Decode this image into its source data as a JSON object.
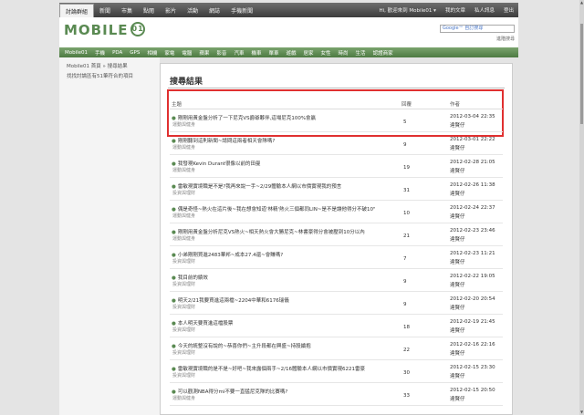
{
  "topnav": {
    "items": [
      "討論群組",
      "新聞",
      "市集",
      "點閱",
      "影片",
      "活動",
      "網誌",
      "手機新聞"
    ],
    "active": "討論群組",
    "right": [
      "Hi, 歡迎來到 Mobile01 ▾",
      "我的文章",
      "私人訊息",
      "登出"
    ]
  },
  "header": {
    "logo_text": "MOBILE",
    "logo_mark": "01",
    "search_placeholder": "Google™ 自訂搜尋",
    "advanced_label": "進階搜尋"
  },
  "categories": [
    "Mobile01",
    "手機",
    "PDA",
    "GPS",
    "相機",
    "家電",
    "電腦",
    "蘋果",
    "影音",
    "汽車",
    "機車",
    "單車",
    "遊戲",
    "居家",
    "女性",
    "時尚",
    "生活",
    "認證商家"
  ],
  "sidebar": {
    "breadcrumb": "Mobile01 首頁 » 搜尋結果",
    "hint": "找找討論區有51筆符合的項目"
  },
  "main": {
    "title": "搜尋結果",
    "columns": {
      "subject": "主題",
      "replies": "回覆",
      "author": "作者"
    },
    "rows": [
      {
        "title": "剛剛用黃金盤分析了一下尼克VS爵爺夥伴,這場尼克100%會贏",
        "section": "運動與健身",
        "replies": "5",
        "date": "2012-03-04 22:35",
        "author": "達賢仔"
      },
      {
        "title": "剛剛聽到這則新聞~請問這兩者相天會隊嗎?",
        "section": "運動與健身",
        "replies": "9",
        "date": "2012-03-01 22:22",
        "author": "達賢仔"
      },
      {
        "title": "我發現Kevin Durant很像以前的田曼",
        "section": "運動與健身",
        "replies": "19",
        "date": "2012-02-28 21:05",
        "author": "達賢仔"
      },
      {
        "title": "雷敏現實境職是不是?我再來說一手~2/29體驗本人網以市價實現我的預言",
        "section": "投資與理財",
        "replies": "31",
        "date": "2012-02-26 11:38",
        "author": "達賢仔"
      },
      {
        "title": "偶是奇怪~熱火在這片後~我在想會知道'林精'熱火三個都同LIN~是不是讓他得分不破10\"",
        "section": "運動與健身",
        "replies": "10",
        "date": "2012-02-24 22:37",
        "author": "達賢仔"
      },
      {
        "title": "剛剛用黃金盤分析尼克VS熱火~相天熱火會大勝尼克~林書豪得分會被壓到10分以內",
        "section": "運動與健身",
        "replies": "21",
        "date": "2012-02-23 23:46",
        "author": "達賢仔"
      },
      {
        "title": "小弟剛剛買進2483華邦~成本27.4還~會賺嗎?",
        "section": "投資與理財",
        "replies": "7",
        "date": "2012-02-23 11:21",
        "author": "達賢仔"
      },
      {
        "title": "我目前的績效",
        "section": "投資與理財",
        "replies": "9",
        "date": "2012-02-22 19:05",
        "author": "達賢仔"
      },
      {
        "title": "明天2/21我要買進這兩檔~2204中華和6176瑞儀",
        "section": "投資與理財",
        "replies": "9",
        "date": "2012-02-20 20:54",
        "author": "達賢仔"
      },
      {
        "title": "本人明天要買進這檔股票",
        "section": "投資與理財",
        "replies": "18",
        "date": "2012-02-19 21:45",
        "author": "達賢仔"
      },
      {
        "title": "今天的統整沒有說的~恭喜你們~主升段都在興盛~持股續抱",
        "section": "投資與理財",
        "replies": "22",
        "date": "2012-02-16 22:16",
        "author": "達賢仔"
      },
      {
        "title": "雷敏現實境職的是不是~好吧~我來露個兩手~2/16體驗本人網以市價實現6221雷豪",
        "section": "投資與理財",
        "replies": "30",
        "date": "2012-02-15 23:30",
        "author": "達賢仔"
      },
      {
        "title": "可以觀測NBA得分mi不要一直猛尼克隊的比賽嗎?",
        "section": "運動與健身",
        "replies": "33",
        "date": "2012-02-15 20:50",
        "author": "達賢仔"
      }
    ]
  }
}
